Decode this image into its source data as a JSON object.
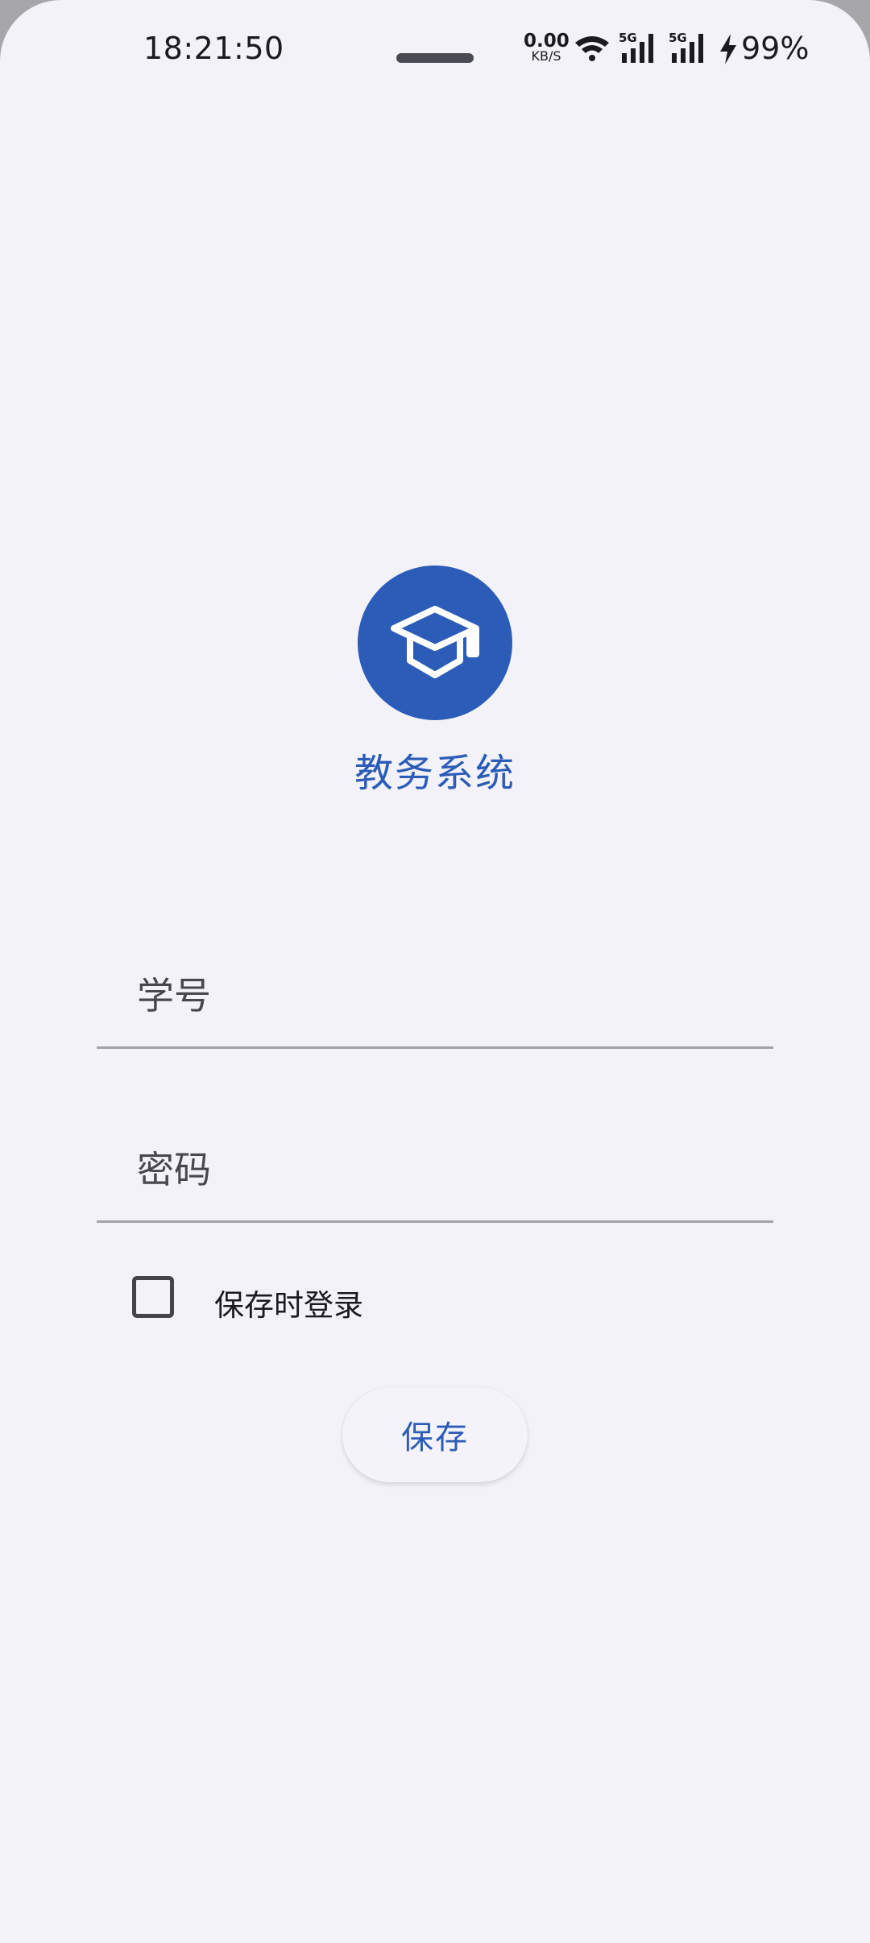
{
  "status_bar": {
    "time": "18:21:50",
    "net_speed_value": "0.00",
    "net_speed_unit": "KB/S",
    "sim1_label": "5G",
    "sim2_label": "5G",
    "battery_percent": "99%"
  },
  "app": {
    "title": "教务系统",
    "brand_color": "#2b5cb7",
    "logo_icon": "graduation-cap-icon"
  },
  "form": {
    "student_id_placeholder": "学号",
    "password_placeholder": "密码",
    "login_on_save_label": "保存时登录",
    "login_on_save_checked": false,
    "save_button_label": "保存"
  }
}
